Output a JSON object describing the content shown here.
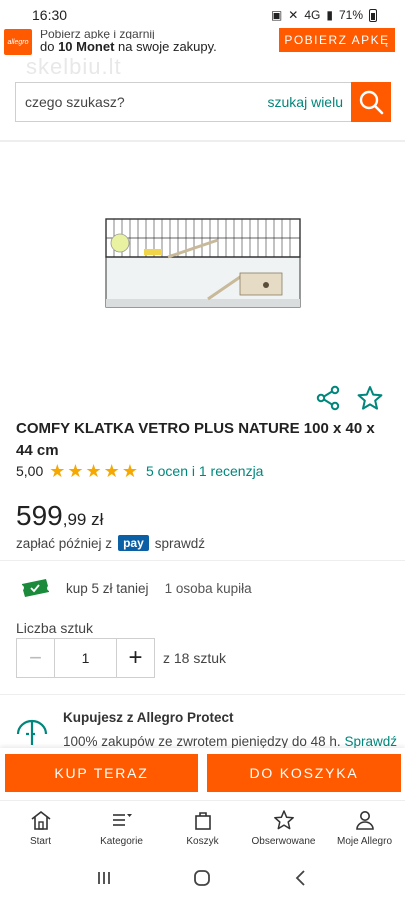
{
  "status_bar": {
    "time": "16:30",
    "signal_text": "4G",
    "battery": "71%"
  },
  "promo": {
    "logo_text": "allegro",
    "line1": "Pobierz apkę i zgarnij",
    "line2_prefix": "do ",
    "line2_bold": "10 Monet",
    "line2_suffix": " na swoje zakupy.",
    "button_label": "POBIERZ APKĘ"
  },
  "watermark": "skelbiu.lt",
  "search": {
    "placeholder": "czego szukasz?",
    "many_link": "szukaj wielu"
  },
  "product": {
    "title": "COMFY KLATKA VETRO PLUS NATURE 100 x 40 x 44 cm",
    "rating_value": "5,00",
    "stars": 5,
    "reviews_text": "5 ocen i 1 recenzja",
    "price_main": "599",
    "price_fraction": ",99 zł",
    "pay_prefix": "zapłać później z",
    "pay_logo": "pay",
    "pay_suffix": "sprawdź"
  },
  "offer": {
    "discount_text": "kup 5 zł taniej",
    "bought_text": "1 osoba kupiła"
  },
  "quantity": {
    "label": "Liczba sztuk",
    "minus": "−",
    "value": "1",
    "plus": "+",
    "of_text": "z 18 sztuk"
  },
  "protect": {
    "title": "Kupujesz z Allegro Protect",
    "text": "100% zakupów ze zwrotem pieniędzy do 48 h.",
    "link": "Sprawdź"
  },
  "actions": {
    "buy_now": "KUP TERAZ",
    "add_to_cart": "DO KOSZYKA"
  },
  "bottom_nav": [
    {
      "label": "Start",
      "icon": "home-icon"
    },
    {
      "label": "Kategorie",
      "icon": "menu-icon"
    },
    {
      "label": "Koszyk",
      "icon": "bag-icon"
    },
    {
      "label": "Obserwowane",
      "icon": "star-icon"
    },
    {
      "label": "Moje Allegro",
      "icon": "user-icon"
    }
  ],
  "colors": {
    "accent": "#ff5a00",
    "link": "#00877c",
    "star": "#f6a800",
    "pay": "#0b5fa5"
  }
}
